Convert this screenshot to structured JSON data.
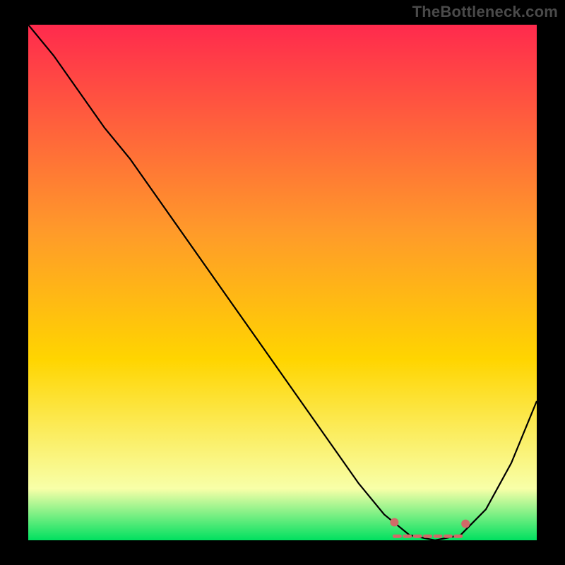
{
  "watermark": "TheBottleneck.com",
  "chart_data": {
    "type": "line",
    "title": "",
    "xlabel": "",
    "ylabel": "",
    "xlim": [
      0,
      100
    ],
    "ylim": [
      0,
      100
    ],
    "grid": false,
    "legend": false,
    "background_gradient_top": "#ff2a4d",
    "background_gradient_mid": "#ffd500",
    "background_gradient_bottom": "#00e060",
    "series": [
      {
        "name": "bottleneck-curve",
        "color": "#000000",
        "x": [
          0,
          5,
          10,
          15,
          20,
          25,
          30,
          35,
          40,
          45,
          50,
          55,
          60,
          65,
          70,
          75,
          80,
          85,
          90,
          95,
          100
        ],
        "values": [
          100,
          94,
          87,
          80,
          74,
          67,
          60,
          53,
          46,
          39,
          32,
          25,
          18,
          11,
          5,
          1,
          0,
          1,
          6,
          15,
          27
        ]
      }
    ],
    "flat_zone": {
      "name": "optimal-range",
      "color": "#d06a68",
      "x_start": 72,
      "x_end": 86,
      "y": 0.8,
      "endpoint_left": {
        "x": 72,
        "y": 3.5
      },
      "endpoint_right": {
        "x": 86,
        "y": 3.2
      }
    }
  }
}
